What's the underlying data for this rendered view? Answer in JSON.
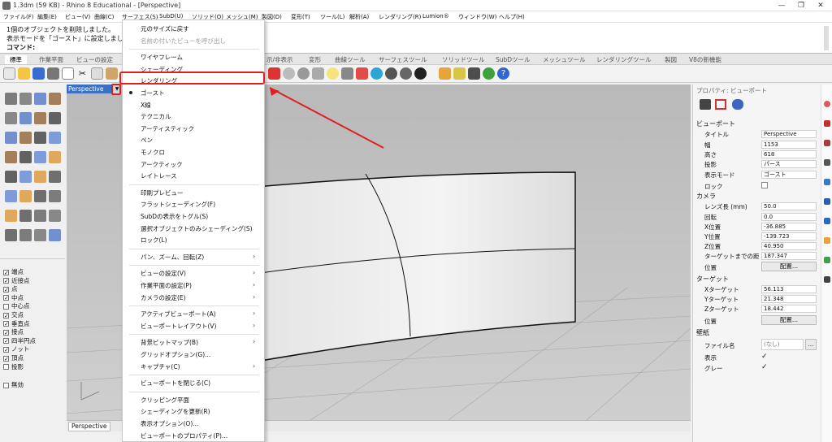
{
  "window": {
    "title": "1.3dm (59 KB) - Rhino 8 Educational - [Perspective]",
    "controls": [
      "—",
      "❐",
      "✕"
    ]
  },
  "menubar": [
    "ファイル(F)",
    "編集(E)",
    "ビュー(V)",
    "曲線(C)",
    "サーフェス(S)",
    "SubD(U)",
    "ソリッド(O)",
    "メッシュ(M)",
    "製図(D)",
    "変形(T)",
    "ツール(L)",
    "解析(A)",
    "レンダリング(R)",
    "Lumion®",
    "ウィンドウ(W)",
    "ヘルプ(H)"
  ],
  "command": {
    "line1": "1個のオブジェクトを削除しました。",
    "line2": "表示モードを「ゴースト」に設定しました",
    "prompt": "コマンド:"
  },
  "toolbar_tabs": [
    "標準",
    "作業平面",
    "ビューの設定",
    "示/非表示",
    "変形",
    "曲線ツール",
    "サーフェスツール",
    "ソリッドツール",
    "SubDツール",
    "メッシュツール",
    "レンダリングツール",
    "製図",
    "V8の新機能"
  ],
  "viewport": {
    "label": "Perspective",
    "bottom_tab": "Perspective"
  },
  "osnap": [
    {
      "label": "端点",
      "checked": true
    },
    {
      "label": "近接点",
      "checked": true
    },
    {
      "label": "点",
      "checked": true
    },
    {
      "label": "中点",
      "checked": true
    },
    {
      "label": "中心点",
      "checked": false
    },
    {
      "label": "交点",
      "checked": true
    },
    {
      "label": "垂直点",
      "checked": true
    },
    {
      "label": "接点",
      "checked": true
    },
    {
      "label": "四半円点",
      "checked": true
    },
    {
      "label": "ノット",
      "checked": true
    },
    {
      "label": "頂点",
      "checked": true
    },
    {
      "label": "投影",
      "checked": false
    },
    {
      "label": "無効",
      "checked": false
    }
  ],
  "menu": {
    "items": [
      {
        "label": "元のサイズに戻す",
        "disabled": false
      },
      {
        "label": "名前の付いたビューを呼び出し",
        "disabled": true
      },
      {
        "label": "ワイヤフレーム"
      },
      {
        "label": "シェーディング"
      },
      {
        "label": "レンダリング",
        "highlighted": true
      },
      {
        "label": "ゴースト",
        "current": true
      },
      {
        "label": "X線"
      },
      {
        "label": "テクニカル"
      },
      {
        "label": "アーティスティック"
      },
      {
        "label": "ペン"
      },
      {
        "label": "モノクロ"
      },
      {
        "label": "アークティック"
      },
      {
        "label": "レイトレース"
      },
      {
        "label": "印刷プレビュー"
      },
      {
        "label": "フラットシェーディング(F)"
      },
      {
        "label": "SubDの表示をトグル(S)"
      },
      {
        "label": "選択オブジェクトのみシェーディング(S)"
      },
      {
        "label": "ロック(L)"
      },
      {
        "label": "パン、ズーム、回転(Z)",
        "submenu": true
      },
      {
        "label": "ビューの設定(V)",
        "submenu": true
      },
      {
        "label": "作業平面の設定(P)",
        "submenu": true
      },
      {
        "label": "カメラの設定(E)",
        "submenu": true
      },
      {
        "label": "アクティブビューポート(A)",
        "submenu": true
      },
      {
        "label": "ビューポートレイアウト(V)",
        "submenu": true
      },
      {
        "label": "背景ビットマップ(B)",
        "submenu": true
      },
      {
        "label": "グリッドオプション(G)..."
      },
      {
        "label": "キャプチャ(C)",
        "submenu": true
      },
      {
        "label": "ビューポートを閉じる(C)"
      },
      {
        "label": "クリッピング平面"
      },
      {
        "label": "シェーディングを更新(R)"
      },
      {
        "label": "表示オプション(O)..."
      },
      {
        "label": "ビューポートのプロパティ(P)..."
      }
    ]
  },
  "properties": {
    "header": "プロパティ: ビューポート",
    "viewport_section": "ビューポート",
    "title_label": "タイトル",
    "title_value": "Perspective",
    "width_label": "幅",
    "width_value": "1153",
    "height_label": "高さ",
    "height_value": "618",
    "projection_label": "投影",
    "projection_value": "パース",
    "display_mode_label": "表示モード",
    "display_mode_value": "ゴースト",
    "lock_label": "ロック",
    "camera_section": "カメラ",
    "lens_label": "レンズ長 (mm)",
    "lens_value": "50.0",
    "rotation_label": "回転",
    "rotation_value": "0.0",
    "x_label": "X位置",
    "x_value": "-36.885",
    "y_label": "Y位置",
    "y_value": "-139.723",
    "z_label": "Z位置",
    "z_value": "40.950",
    "dist_label": "ターゲットまでの距",
    "dist_value": "187.347",
    "position_label": "位置",
    "place_button": "配置...",
    "target_section": "ターゲット",
    "tx_label": "Xターゲット",
    "tx_value": "56.113",
    "ty_label": "Yターゲット",
    "ty_value": "21.348",
    "tz_label": "Zターゲット",
    "tz_value": "18.442",
    "target_position_label": "位置",
    "target_place_button": "配置...",
    "wallpaper_section": "壁紙",
    "filename_label": "ファイル名",
    "filename_value": "(なし)",
    "browse_button": "...",
    "show_label": "表示",
    "gray_label": "グレー"
  },
  "colors": {
    "accent_red": "#e02020",
    "viewport_bg": "#c2c2c2",
    "viewport_label_bg": "#3b6fbf"
  }
}
